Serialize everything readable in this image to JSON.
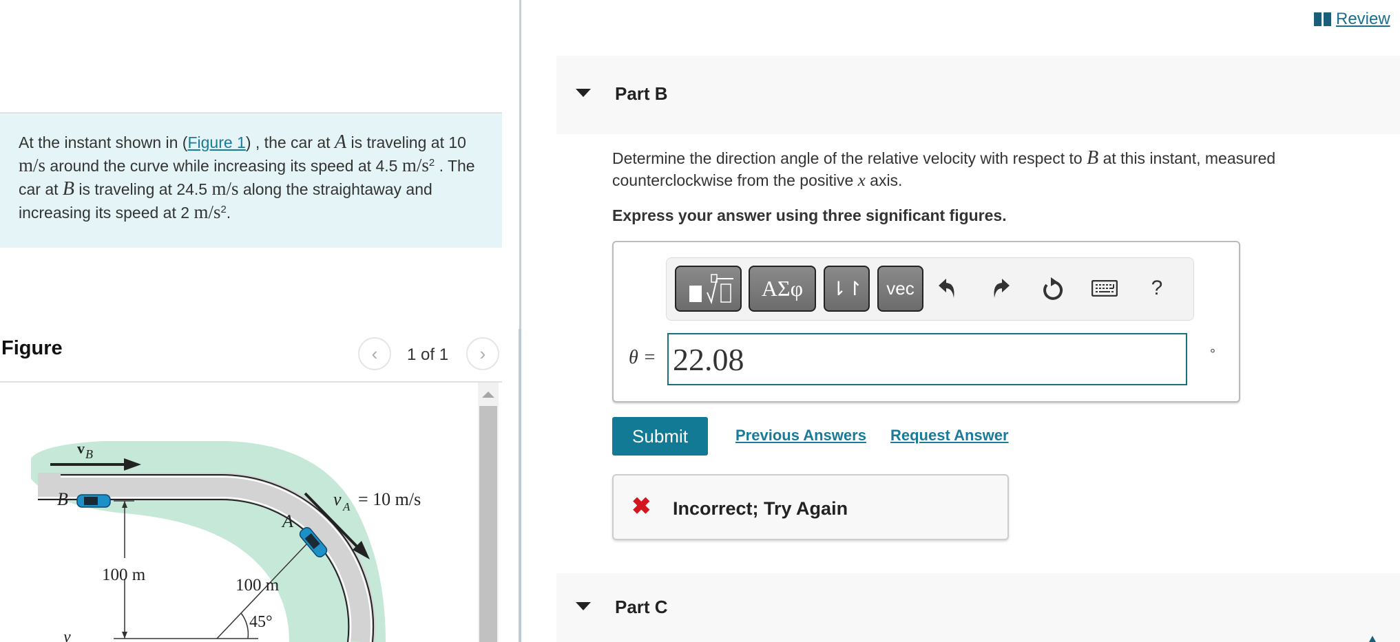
{
  "review": {
    "label": "Review",
    "icon": "book-icon"
  },
  "problem": {
    "intro": "At the instant shown in (",
    "figure_link": "Figure 1",
    "s1": ") , the car at ",
    "varA": "A",
    "s2": " is traveling at 10 ",
    "unit_ms": "m/s",
    "s3": " around the curve while increasing its speed at 4.5 ",
    "unit_ms2": "m/s",
    "sq": "2",
    "s4": " . The car at ",
    "varB": "B",
    "s5": " is traveling at 24.5 ",
    "unit_ms_b": "m/s",
    "s6": " along the straightaway and increasing its speed at 2 ",
    "unit_ms2_b": "m/s",
    "sq_b": "2",
    "s7": "."
  },
  "figure": {
    "title": "Figure",
    "counter": "1 of 1",
    "prev_icon": "chevron-left-icon",
    "next_icon": "chevron-right-icon",
    "labels": {
      "vB": "v",
      "vB_sub": "B",
      "carB": "B",
      "carA": "A",
      "vA": "v",
      "vA_sub": "A",
      "vA_value": "= 10 m/s",
      "dist1": "100 m",
      "dist2": "100 m",
      "angle": "45°",
      "axis_y": "y"
    }
  },
  "partB": {
    "label": "Part B",
    "question_1": "Determine the direction angle of the relative velocity with respect to ",
    "question_var": "B",
    "question_2": " at this instant, measured counterclockwise from the positive ",
    "question_x": "x",
    "question_3": " axis.",
    "instruction": "Express your answer using three significant figures.",
    "toolbar": {
      "templates": "templates-icon",
      "greek": "ΑΣφ",
      "arrows": "⇂↾",
      "vec": "vec",
      "undo": "undo-icon",
      "redo": "redo-icon",
      "reset": "reset-icon",
      "keyboard": "keyboard-icon",
      "help": "?"
    },
    "answer_label": "θ =",
    "answer_value": "22.08",
    "unit": "°",
    "submit": "Submit",
    "previous_answers": "Previous Answers",
    "request_answer": "Request Answer",
    "feedback": {
      "icon": "✖",
      "message": "Incorrect; Try Again",
      "color": "#d4161e"
    }
  },
  "partC": {
    "label": "Part C"
  },
  "colors": {
    "accent": "#137a96",
    "link": "#1a7a9a",
    "problem_bg": "#e5f5f7",
    "input_border": "#1a6f7f"
  }
}
